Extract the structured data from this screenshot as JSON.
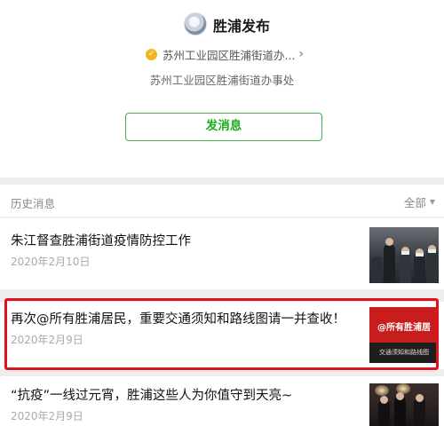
{
  "account": {
    "name": "胜浦发布",
    "verification_text": "苏州工业园区胜浦街道办...",
    "organization": "苏州工业园区胜浦街道办事处"
  },
  "actions": {
    "send_message_label": "发消息"
  },
  "history": {
    "label": "历史消息",
    "filter_label": "全部"
  },
  "articles": [
    {
      "title": "朱江督查胜浦街道疫情防控工作",
      "date": "2020年2月10日",
      "thumbnail": "officials-inspection-photo"
    },
    {
      "title": "再次@所有胜浦居民，重要交通须知和路线图请一并查收！",
      "date": "2020年2月9日",
      "thumbnail_text": "@所有胜浦居",
      "thumbnail_subtext": "交通须知和路线图",
      "highlighted": true
    },
    {
      "title": "“抗疫”一线过元宵，胜浦这些人为你值守到天亮~",
      "date": "2020年2月9日",
      "thumbnail": "night-duty-photo"
    }
  ],
  "colors": {
    "accent_green": "#1aad19",
    "highlight_red": "#e0131d",
    "verify_badge": "#f3b41f"
  },
  "icons": {
    "verified": "check-badge-icon",
    "chevron": "chevron-right-icon",
    "dropdown": "triangle-down-icon"
  }
}
